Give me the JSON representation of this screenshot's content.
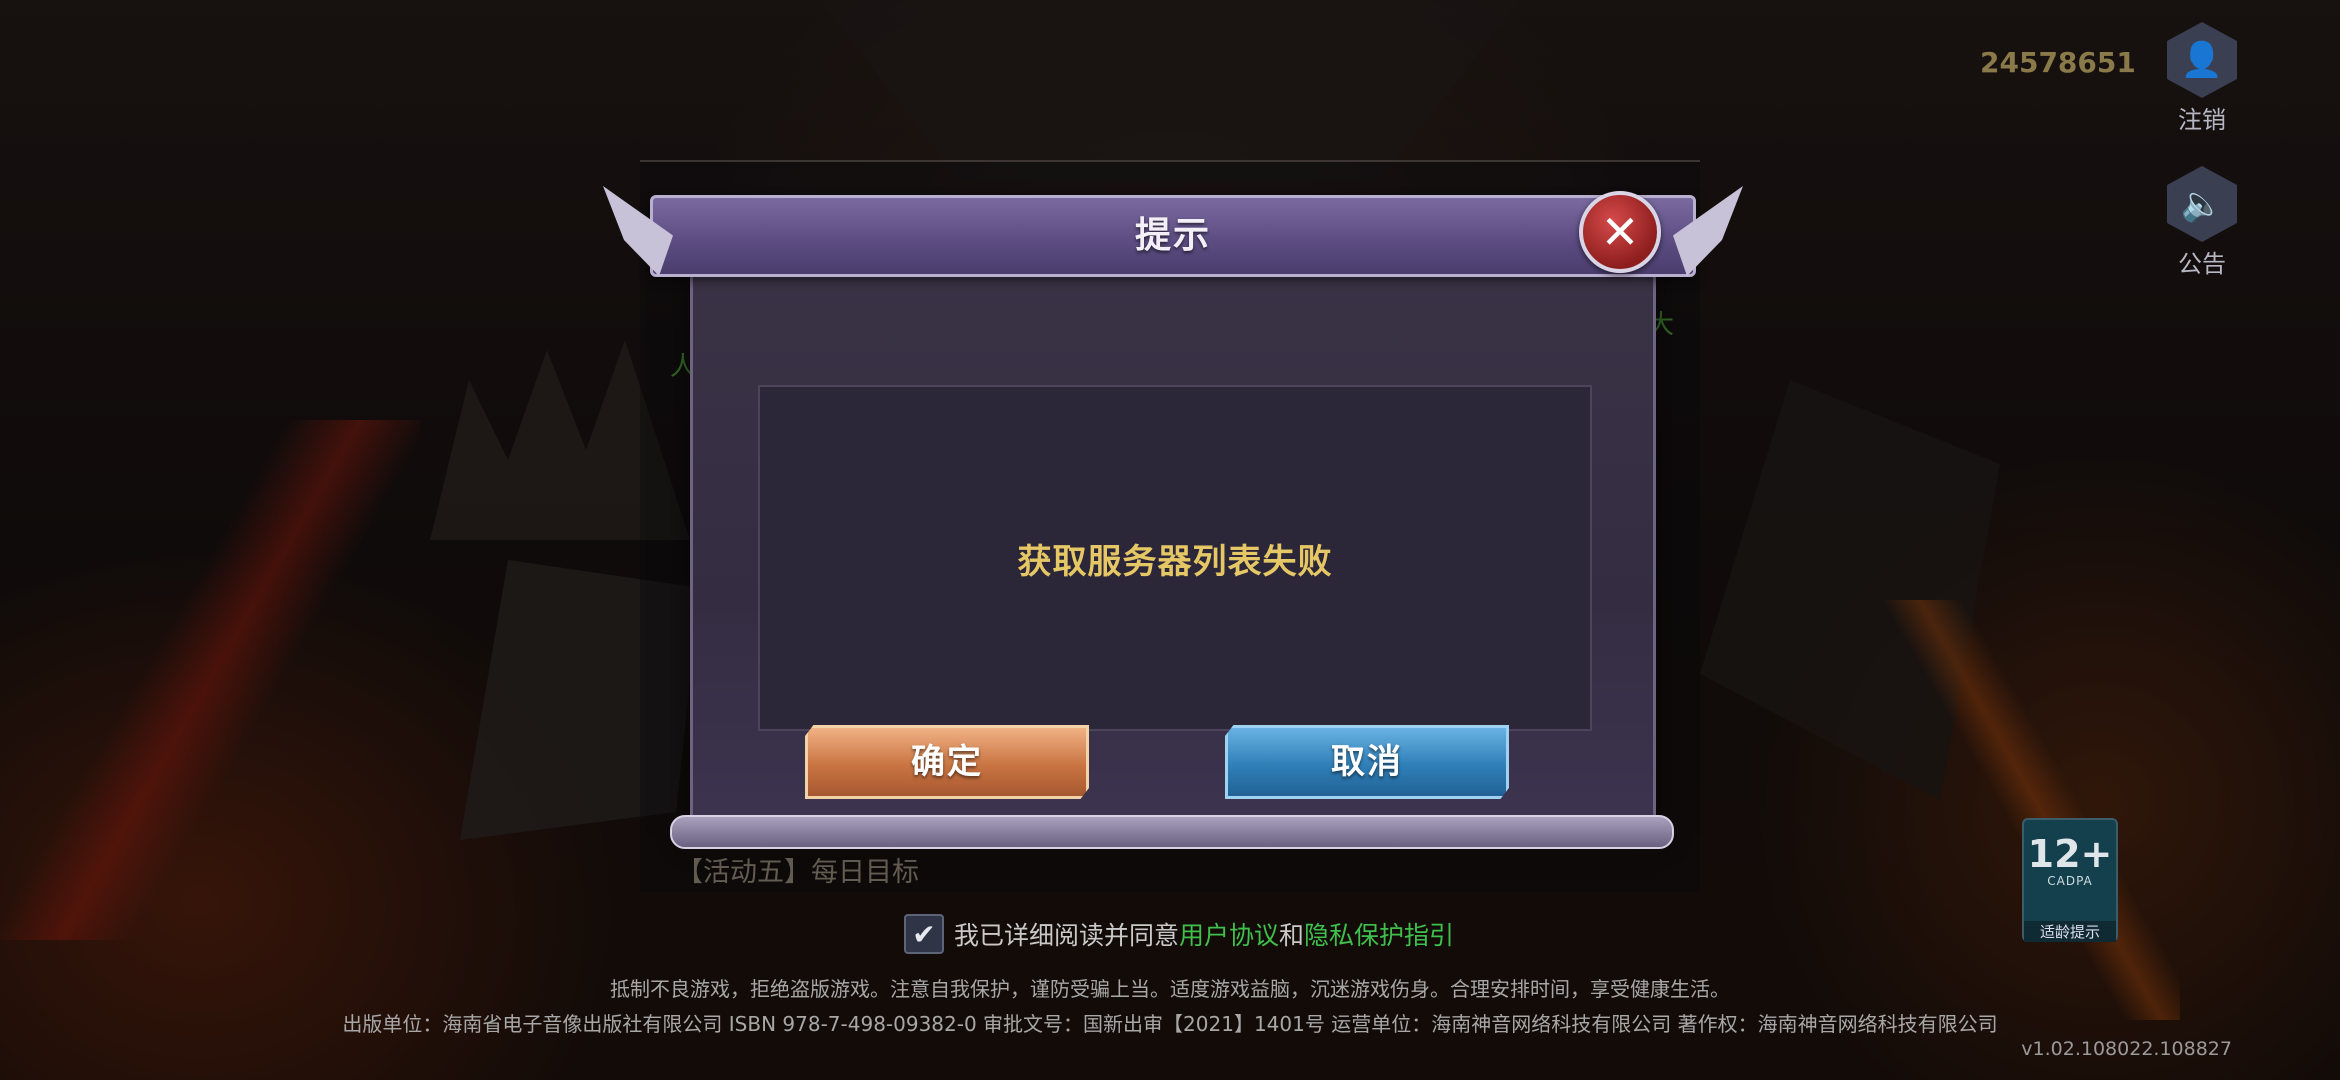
{
  "top_right": {
    "uid": "24578651",
    "logout_label": "注销",
    "notice_label": "公告"
  },
  "underlay": {
    "green_fragment_right": "大",
    "green_fragment_left": "人",
    "activity5": "【活动五】每日目标"
  },
  "dialog": {
    "title": "提示",
    "message": "获取服务器列表失败",
    "confirm_label": "确定",
    "cancel_label": "取消",
    "close_symbol": "✕"
  },
  "agreement": {
    "prefix": "我已详细阅读并同意",
    "user_agreement": "用户协议",
    "and": "和",
    "privacy": "隐私保护指引",
    "checked": true
  },
  "rating": {
    "age": "12+",
    "org": "CADPA",
    "tip": "适龄提示"
  },
  "footer": {
    "health_notice": "抵制不良游戏，拒绝盗版游戏。注意自我保护，谨防受骗上当。适度游戏益脑，沉迷游戏伤身。合理安排时间，享受健康生活。",
    "publisher": "出版单位：海南省电子音像出版社有限公司 ISBN 978-7-498-09382-0 审批文号：国新出审【2021】1401号 运营单位：海南神音网络科技有限公司 著作权：海南神音网络科技有限公司",
    "version": "v1.02.108022.108827"
  },
  "icons": {
    "user": "👤",
    "speaker": "🔈",
    "check": "✔"
  }
}
